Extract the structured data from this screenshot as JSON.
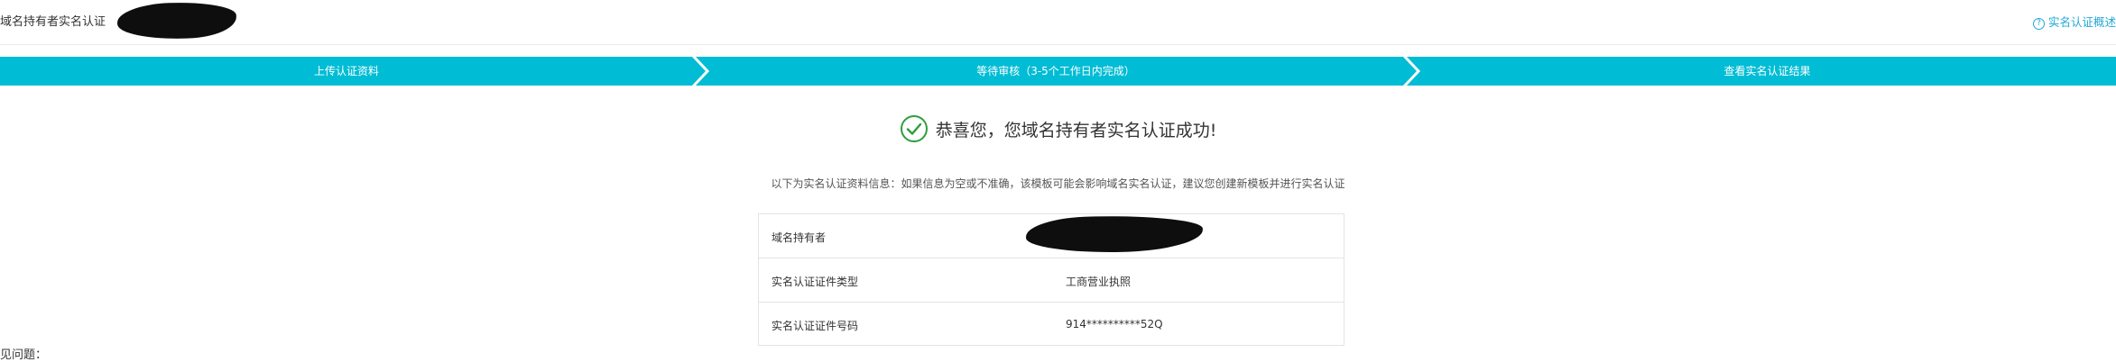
{
  "header": {
    "title": "域名持有者实名认证",
    "overview_link": "实名认证概述"
  },
  "steps": [
    {
      "label": "上传认证资料"
    },
    {
      "label": "等待审核（3-5个工作日内完成）"
    },
    {
      "label": "查看实名认证结果"
    }
  ],
  "result": {
    "message": "恭喜您，您域名持有者实名认证成功!",
    "note": "以下为实名认证资料信息：如果信息为空或不准确，该模板可能会影响域名实名认证，建议您创建新模板并进行实名认证"
  },
  "info_rows": [
    {
      "label": "域名持有者",
      "value": ""
    },
    {
      "label": "实名认证证件类型",
      "value": "工商营业执照"
    },
    {
      "label": "实名认证证件号码",
      "value": "914**********52Q"
    }
  ],
  "faq": {
    "title": "见问题："
  },
  "colors": {
    "stepper": "#00bcd4",
    "accent_link": "#20a8d8",
    "success": "#2e9e3f"
  },
  "icons": {
    "help": "question-circle-icon",
    "success": "check-circle-icon"
  }
}
